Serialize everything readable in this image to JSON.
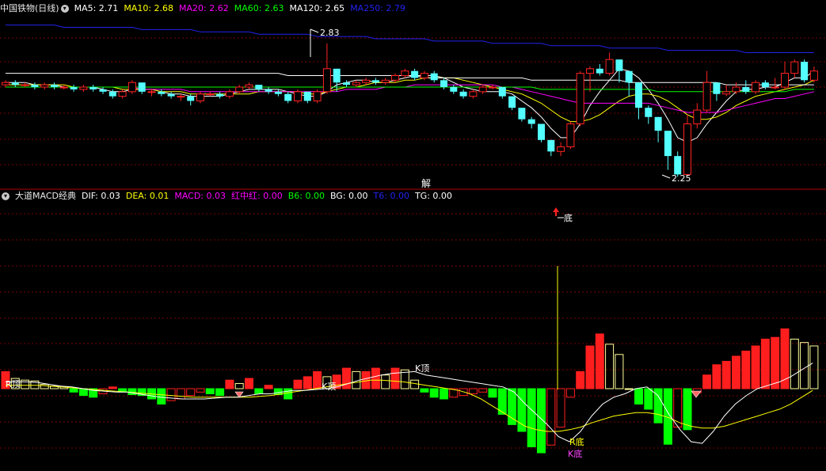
{
  "main_pane": {
    "stock_title": "中国铁物(日线)",
    "legend": [
      {
        "label": "MA5: 2.71",
        "color": "#ffffff"
      },
      {
        "label": "MA10: 2.68",
        "color": "#ffff00"
      },
      {
        "label": "MA20: 2.62",
        "color": "#ff00ff"
      },
      {
        "label": "MA60: 2.63",
        "color": "#00ff00"
      },
      {
        "label": "MA120: 2.65",
        "color": "#ffffff"
      },
      {
        "label": "MA250: 2.79",
        "color": "#2222ee"
      }
    ],
    "high_label": "2.83",
    "low_label": "2.25",
    "jie_label": "解"
  },
  "sub_pane": {
    "indicator_title": "大道MACD经典",
    "legend": [
      {
        "label": "DIF: 0.03",
        "color": "#ffffff"
      },
      {
        "label": "DEA: 0.01",
        "color": "#ffff00"
      },
      {
        "label": "MACD: 0.03",
        "color": "#ff00ff"
      },
      {
        "label": "红中红: 0.00",
        "color": "#ff00ff"
      },
      {
        "label": "B6: 0.00",
        "color": "#00ff00"
      },
      {
        "label": "BG: 0.00",
        "color": "#ffffff"
      },
      {
        "label": "T6: 0.00",
        "color": "#2222ee"
      },
      {
        "label": "TG: 0.00",
        "color": "#ffffff"
      }
    ],
    "annotations": {
      "bottom_marker": "底",
      "r_top": "R顶",
      "k_top_a": "K顶",
      "k_top_b": "K顶",
      "r_bottom": "R底",
      "k_bottom": "K底"
    }
  },
  "colors": {
    "up": "#ff2222",
    "down": "#54ffff",
    "macd_pos": "#ff1e1e",
    "macd_neg": "#00ff00",
    "macd_weak": "#ffff99",
    "grid": "#7a0000",
    "divider": "#b40000"
  },
  "chart_data": {
    "type": "candlestick",
    "candles": [
      [
        2.65,
        2.66,
        2.64,
        2.67
      ],
      [
        2.66,
        2.65,
        2.64,
        2.67
      ],
      [
        2.65,
        2.65,
        2.64,
        2.66
      ],
      [
        2.65,
        2.64,
        2.63,
        2.66
      ],
      [
        2.64,
        2.65,
        2.63,
        2.66
      ],
      [
        2.65,
        2.64,
        2.63,
        2.66
      ],
      [
        2.64,
        2.64,
        2.63,
        2.65
      ],
      [
        2.64,
        2.63,
        2.62,
        2.65
      ],
      [
        2.63,
        2.64,
        2.62,
        2.65
      ],
      [
        2.64,
        2.63,
        2.62,
        2.65
      ],
      [
        2.63,
        2.62,
        2.61,
        2.64
      ],
      [
        2.62,
        2.6,
        2.59,
        2.63
      ],
      [
        2.6,
        2.62,
        2.59,
        2.63
      ],
      [
        2.62,
        2.66,
        2.61,
        2.67
      ],
      [
        2.66,
        2.62,
        2.61,
        2.66
      ],
      [
        2.62,
        2.62,
        2.6,
        2.63
      ],
      [
        2.62,
        2.61,
        2.6,
        2.63
      ],
      [
        2.61,
        2.6,
        2.59,
        2.62
      ],
      [
        2.6,
        2.6,
        2.58,
        2.61
      ],
      [
        2.6,
        2.58,
        2.56,
        2.61
      ],
      [
        2.58,
        2.61,
        2.57,
        2.62
      ],
      [
        2.61,
        2.61,
        2.6,
        2.62
      ],
      [
        2.61,
        2.6,
        2.59,
        2.62
      ],
      [
        2.6,
        2.62,
        2.59,
        2.63
      ],
      [
        2.62,
        2.64,
        2.61,
        2.65
      ],
      [
        2.64,
        2.65,
        2.63,
        2.66
      ],
      [
        2.65,
        2.63,
        2.62,
        2.65
      ],
      [
        2.63,
        2.62,
        2.61,
        2.64
      ],
      [
        2.62,
        2.61,
        2.6,
        2.63
      ],
      [
        2.61,
        2.58,
        2.57,
        2.62
      ],
      [
        2.58,
        2.62,
        2.57,
        2.63
      ],
      [
        2.62,
        2.58,
        2.57,
        2.62
      ],
      [
        2.58,
        2.62,
        2.57,
        2.63
      ],
      [
        2.62,
        2.72,
        2.61,
        2.83
      ],
      [
        2.72,
        2.66,
        2.62,
        2.72
      ],
      [
        2.66,
        2.65,
        2.64,
        2.67
      ],
      [
        2.65,
        2.66,
        2.64,
        2.67
      ],
      [
        2.66,
        2.67,
        2.65,
        2.68
      ],
      [
        2.67,
        2.66,
        2.65,
        2.68
      ],
      [
        2.66,
        2.67,
        2.65,
        2.68
      ],
      [
        2.67,
        2.69,
        2.66,
        2.7
      ],
      [
        2.69,
        2.71,
        2.68,
        2.72
      ],
      [
        2.71,
        2.68,
        2.67,
        2.72
      ],
      [
        2.68,
        2.7,
        2.67,
        2.71
      ],
      [
        2.7,
        2.67,
        2.66,
        2.71
      ],
      [
        2.67,
        2.64,
        2.63,
        2.68
      ],
      [
        2.64,
        2.62,
        2.61,
        2.65
      ],
      [
        2.62,
        2.6,
        2.59,
        2.63
      ],
      [
        2.6,
        2.62,
        2.59,
        2.63
      ],
      [
        2.62,
        2.64,
        2.61,
        2.65
      ],
      [
        2.64,
        2.64,
        2.63,
        2.65
      ],
      [
        2.64,
        2.6,
        2.59,
        2.64
      ],
      [
        2.6,
        2.55,
        2.54,
        2.6
      ],
      [
        2.55,
        2.5,
        2.49,
        2.55
      ],
      [
        2.5,
        2.48,
        2.46,
        2.51
      ],
      [
        2.48,
        2.41,
        2.4,
        2.48
      ],
      [
        2.41,
        2.36,
        2.34,
        2.41
      ],
      [
        2.36,
        2.38,
        2.34,
        2.4
      ],
      [
        2.38,
        2.48,
        2.37,
        2.49
      ],
      [
        2.48,
        2.7,
        2.47,
        2.71
      ],
      [
        2.7,
        2.72,
        2.62,
        2.73
      ],
      [
        2.72,
        2.7,
        2.69,
        2.74
      ],
      [
        2.7,
        2.76,
        2.69,
        2.79
      ],
      [
        2.76,
        2.71,
        2.66,
        2.76
      ],
      [
        2.71,
        2.66,
        2.6,
        2.71
      ],
      [
        2.66,
        2.55,
        2.5,
        2.66
      ],
      [
        2.55,
        2.51,
        2.48,
        2.56
      ],
      [
        2.51,
        2.45,
        2.4,
        2.51
      ],
      [
        2.45,
        2.34,
        2.28,
        2.45
      ],
      [
        2.34,
        2.26,
        2.25,
        2.36
      ],
      [
        2.26,
        2.48,
        2.27,
        2.52
      ],
      [
        2.48,
        2.54,
        2.46,
        2.57
      ],
      [
        2.54,
        2.66,
        2.53,
        2.71
      ],
      [
        2.66,
        2.61,
        2.58,
        2.66
      ],
      [
        2.61,
        2.62,
        2.6,
        2.65
      ],
      [
        2.62,
        2.64,
        2.61,
        2.66
      ],
      [
        2.64,
        2.62,
        2.61,
        2.67
      ],
      [
        2.62,
        2.66,
        2.61,
        2.67
      ],
      [
        2.66,
        2.64,
        2.63,
        2.67
      ],
      [
        2.64,
        2.64,
        2.63,
        2.68
      ],
      [
        2.64,
        2.7,
        2.63,
        2.75
      ],
      [
        2.7,
        2.75,
        2.68,
        2.76
      ],
      [
        2.75,
        2.67,
        2.66,
        2.76
      ],
      [
        2.67,
        2.71,
        2.66,
        2.73
      ]
    ],
    "ma": [
      {
        "name": "MA5",
        "color": "#ffffff",
        "values": [
          2.66,
          2.66,
          2.66,
          2.65,
          2.65,
          2.65,
          2.64,
          2.64,
          2.64,
          2.64,
          2.63,
          2.62,
          2.62,
          2.63,
          2.63,
          2.63,
          2.62,
          2.61,
          2.61,
          2.6,
          2.6,
          2.6,
          2.6,
          2.61,
          2.62,
          2.63,
          2.63,
          2.63,
          2.63,
          2.62,
          2.61,
          2.6,
          2.6,
          2.62,
          2.65,
          2.66,
          2.67,
          2.67,
          2.66,
          2.66,
          2.67,
          2.68,
          2.69,
          2.69,
          2.69,
          2.68,
          2.66,
          2.64,
          2.63,
          2.62,
          2.62,
          2.62,
          2.61,
          2.58,
          2.55,
          2.51,
          2.46,
          2.42,
          2.42,
          2.48,
          2.56,
          2.62,
          2.67,
          2.72,
          2.71,
          2.68,
          2.63,
          2.57,
          2.5,
          2.42,
          2.4,
          2.42,
          2.48,
          2.53,
          2.58,
          2.62,
          2.63,
          2.63,
          2.64,
          2.64,
          2.66,
          2.68,
          2.68,
          2.71
        ]
      },
      {
        "name": "MA10",
        "color": "#ffff00",
        "values": [
          2.65,
          2.65,
          2.65,
          2.65,
          2.65,
          2.65,
          2.65,
          2.64,
          2.64,
          2.64,
          2.64,
          2.64,
          2.63,
          2.63,
          2.63,
          2.63,
          2.62,
          2.62,
          2.62,
          2.61,
          2.61,
          2.61,
          2.61,
          2.61,
          2.61,
          2.61,
          2.62,
          2.62,
          2.62,
          2.62,
          2.62,
          2.61,
          2.61,
          2.62,
          2.63,
          2.64,
          2.64,
          2.65,
          2.66,
          2.66,
          2.66,
          2.67,
          2.67,
          2.68,
          2.68,
          2.68,
          2.68,
          2.67,
          2.66,
          2.65,
          2.64,
          2.63,
          2.62,
          2.61,
          2.59,
          2.57,
          2.54,
          2.51,
          2.49,
          2.49,
          2.5,
          2.52,
          2.55,
          2.58,
          2.6,
          2.61,
          2.61,
          2.6,
          2.58,
          2.55,
          2.52,
          2.5,
          2.5,
          2.51,
          2.53,
          2.56,
          2.58,
          2.6,
          2.61,
          2.62,
          2.63,
          2.64,
          2.65,
          2.67
        ]
      },
      {
        "name": "MA20",
        "color": "#ff00ff",
        "values": [
          2.64,
          2.64,
          2.64,
          2.64,
          2.64,
          2.64,
          2.64,
          2.64,
          2.64,
          2.64,
          2.64,
          2.64,
          2.64,
          2.64,
          2.63,
          2.63,
          2.63,
          2.63,
          2.63,
          2.62,
          2.62,
          2.62,
          2.62,
          2.62,
          2.62,
          2.62,
          2.62,
          2.62,
          2.62,
          2.62,
          2.62,
          2.62,
          2.62,
          2.62,
          2.62,
          2.63,
          2.63,
          2.63,
          2.63,
          2.64,
          2.64,
          2.64,
          2.65,
          2.65,
          2.65,
          2.65,
          2.65,
          2.65,
          2.65,
          2.65,
          2.65,
          2.64,
          2.64,
          2.63,
          2.62,
          2.61,
          2.6,
          2.59,
          2.58,
          2.57,
          2.57,
          2.57,
          2.57,
          2.57,
          2.57,
          2.57,
          2.57,
          2.56,
          2.55,
          2.54,
          2.53,
          2.53,
          2.53,
          2.53,
          2.54,
          2.55,
          2.56,
          2.57,
          2.58,
          2.59,
          2.59,
          2.6,
          2.61,
          2.62
        ]
      },
      {
        "name": "MA60",
        "color": "#00ff00",
        "values": [
          2.64,
          2.64,
          2.64,
          2.64,
          2.64,
          2.64,
          2.64,
          2.64,
          2.64,
          2.64,
          2.64,
          2.64,
          2.64,
          2.64,
          2.64,
          2.64,
          2.64,
          2.64,
          2.64,
          2.64,
          2.64,
          2.64,
          2.64,
          2.64,
          2.64,
          2.64,
          2.64,
          2.64,
          2.64,
          2.64,
          2.64,
          2.64,
          2.64,
          2.64,
          2.64,
          2.64,
          2.64,
          2.64,
          2.64,
          2.64,
          2.64,
          2.64,
          2.64,
          2.64,
          2.64,
          2.64,
          2.64,
          2.64,
          2.64,
          2.64,
          2.64,
          2.64,
          2.64,
          2.64,
          2.64,
          2.63,
          2.63,
          2.63,
          2.63,
          2.63,
          2.63,
          2.63,
          2.63,
          2.63,
          2.63,
          2.63,
          2.63,
          2.62,
          2.62,
          2.62,
          2.62,
          2.62,
          2.62,
          2.62,
          2.62,
          2.62,
          2.62,
          2.62,
          2.62,
          2.62,
          2.62,
          2.63,
          2.63,
          2.63
        ]
      },
      {
        "name": "MA120",
        "color": "#ffffff",
        "values": [
          2.7,
          2.7,
          2.7,
          2.7,
          2.7,
          2.7,
          2.7,
          2.7,
          2.7,
          2.7,
          2.7,
          2.7,
          2.7,
          2.7,
          2.7,
          2.7,
          2.7,
          2.7,
          2.7,
          2.7,
          2.7,
          2.7,
          2.7,
          2.7,
          2.7,
          2.7,
          2.7,
          2.7,
          2.7,
          2.69,
          2.69,
          2.69,
          2.69,
          2.69,
          2.69,
          2.69,
          2.69,
          2.69,
          2.69,
          2.69,
          2.69,
          2.69,
          2.69,
          2.68,
          2.68,
          2.68,
          2.68,
          2.68,
          2.68,
          2.68,
          2.68,
          2.68,
          2.68,
          2.68,
          2.67,
          2.67,
          2.67,
          2.67,
          2.67,
          2.67,
          2.67,
          2.67,
          2.67,
          2.67,
          2.66,
          2.66,
          2.66,
          2.66,
          2.66,
          2.66,
          2.66,
          2.66,
          2.66,
          2.66,
          2.65,
          2.65,
          2.65,
          2.65,
          2.65,
          2.65,
          2.65,
          2.65,
          2.65,
          2.65
        ]
      },
      {
        "name": "MA250",
        "color": "#2222ee",
        "values": [
          2.91,
          2.91,
          2.91,
          2.91,
          2.91,
          2.91,
          2.9,
          2.9,
          2.9,
          2.9,
          2.9,
          2.9,
          2.9,
          2.9,
          2.89,
          2.89,
          2.89,
          2.89,
          2.89,
          2.89,
          2.88,
          2.88,
          2.88,
          2.88,
          2.88,
          2.88,
          2.87,
          2.87,
          2.87,
          2.87,
          2.87,
          2.87,
          2.86,
          2.86,
          2.86,
          2.86,
          2.86,
          2.86,
          2.85,
          2.85,
          2.85,
          2.85,
          2.85,
          2.85,
          2.84,
          2.84,
          2.84,
          2.84,
          2.84,
          2.84,
          2.83,
          2.83,
          2.83,
          2.83,
          2.83,
          2.83,
          2.82,
          2.82,
          2.82,
          2.82,
          2.82,
          2.82,
          2.81,
          2.81,
          2.81,
          2.81,
          2.81,
          2.81,
          2.8,
          2.8,
          2.8,
          2.8,
          2.8,
          2.8,
          2.8,
          2.8,
          2.79,
          2.79,
          2.79,
          2.79,
          2.79,
          2.79,
          2.79,
          2.79
        ]
      }
    ],
    "macd_hist": [
      0.02,
      0.012,
      0.01,
      0.009,
      0.005,
      0.003,
      0.002,
      -0.004,
      -0.008,
      -0.01,
      -0.006,
      0.002,
      -0.004,
      -0.007,
      -0.008,
      -0.012,
      -0.018,
      -0.014,
      -0.012,
      -0.008,
      -0.004,
      -0.006,
      -0.008,
      0.01,
      0.006,
      0.012,
      -0.006,
      0.004,
      -0.007,
      -0.012,
      0.01,
      0.014,
      0.02,
      0.014,
      0.016,
      0.024,
      0.02,
      0.02,
      0.024,
      0.016,
      0.024,
      0.022,
      0.01,
      -0.004,
      -0.01,
      -0.012,
      -0.01,
      -0.008,
      -0.006,
      -0.004,
      -0.01,
      -0.03,
      -0.042,
      -0.05,
      -0.068,
      -0.075,
      -0.066,
      -0.045,
      -0.01,
      0.02,
      0.05,
      0.064,
      0.052,
      0.04,
      0.0,
      -0.018,
      -0.024,
      -0.04,
      -0.065,
      -0.045,
      -0.048,
      -0.005,
      0.016,
      0.028,
      0.032,
      0.038,
      0.044,
      0.05,
      0.058,
      0.06,
      0.07,
      0.058,
      0.054,
      0.05
    ],
    "dif": [
      0.008,
      0.008,
      0.008,
      0.007,
      0.005,
      0.003,
      0.002,
      0.0,
      -0.002,
      -0.003,
      -0.004,
      -0.004,
      -0.006,
      -0.008,
      -0.01,
      -0.011,
      -0.012,
      -0.012,
      -0.012,
      -0.011,
      -0.01,
      -0.01,
      -0.008,
      -0.006,
      -0.006,
      -0.004,
      -0.002,
      -0.002,
      -0.001,
      0.0,
      0.002,
      0.006,
      0.01,
      0.013,
      0.016,
      0.018,
      0.019,
      0.02,
      0.016,
      0.014,
      0.012,
      0.01,
      0.008,
      0.006,
      0.004,
      0.002,
      -0.004,
      -0.018,
      -0.03,
      -0.042,
      -0.056,
      -0.062,
      -0.05,
      -0.032,
      -0.018,
      -0.01,
      -0.006,
      0.0,
      0.002,
      -0.008,
      -0.03,
      -0.048,
      -0.062,
      -0.064,
      -0.05,
      -0.032,
      -0.018,
      -0.008,
      0.0,
      0.004,
      0.008,
      0.014,
      0.022,
      0.03
    ],
    "dea": [
      0.004,
      0.004,
      0.004,
      0.004,
      0.003,
      0.002,
      0.001,
      0.0,
      -0.001,
      -0.002,
      -0.003,
      -0.004,
      -0.005,
      -0.006,
      -0.007,
      -0.008,
      -0.009,
      -0.01,
      -0.01,
      -0.01,
      -0.01,
      -0.01,
      -0.01,
      -0.009,
      -0.008,
      -0.006,
      -0.004,
      -0.002,
      0.0,
      0.002,
      0.004,
      0.006,
      0.008,
      0.01,
      0.01,
      0.009,
      0.008,
      0.006,
      0.004,
      0.002,
      0.0,
      -0.002,
      -0.006,
      -0.012,
      -0.02,
      -0.028,
      -0.036,
      -0.044,
      -0.048,
      -0.05,
      -0.05,
      -0.048,
      -0.045,
      -0.04,
      -0.036,
      -0.032,
      -0.03,
      -0.028,
      -0.028,
      -0.03,
      -0.034,
      -0.04,
      -0.044,
      -0.046,
      -0.046,
      -0.044,
      -0.04,
      -0.036,
      -0.032,
      -0.028,
      -0.024,
      -0.018,
      -0.01,
      -0.002
    ]
  }
}
